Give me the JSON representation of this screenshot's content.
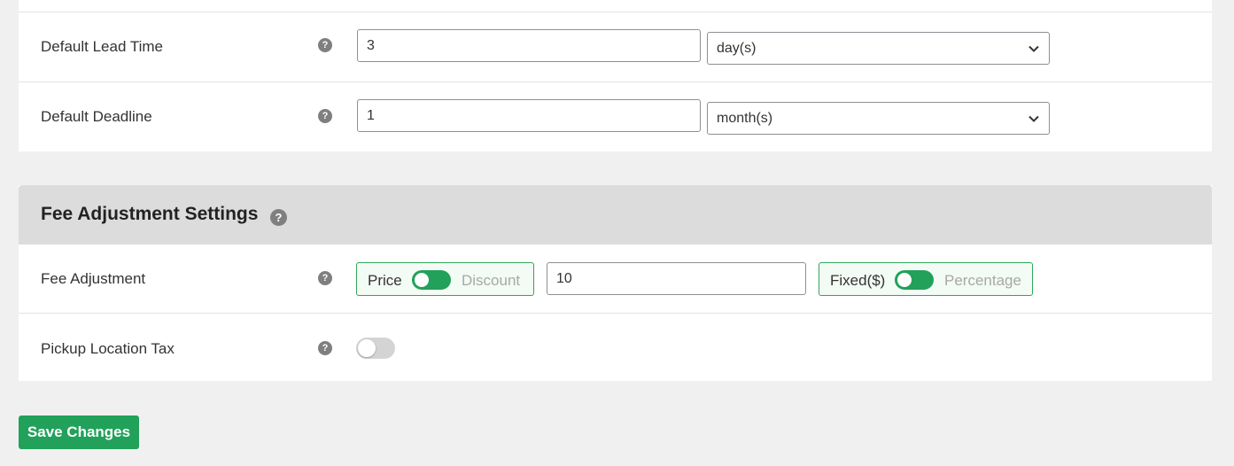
{
  "lead_time": {
    "label": "Default Lead Time",
    "help_icon": "question-icon",
    "value": "3",
    "unit": "day(s)"
  },
  "deadline": {
    "label": "Default Deadline",
    "help_icon": "question-icon",
    "value": "1",
    "unit": "month(s)"
  },
  "fee_section": {
    "title": "Fee Adjustment Settings",
    "help_icon": "question-icon"
  },
  "fee_adjustment": {
    "label": "Fee Adjustment",
    "type_toggle": {
      "left": "Price",
      "right": "Discount",
      "active": "Price"
    },
    "amount": "10",
    "mode_toggle": {
      "left": "Fixed($)",
      "right": "Percentage",
      "active": "Fixed($)"
    }
  },
  "pickup_tax": {
    "label": "Pickup Location Tax",
    "enabled": false
  },
  "save_button": {
    "label": "Save Changes"
  },
  "colors": {
    "accent": "#21a15a",
    "header_bg": "#dcdcdc",
    "page_bg": "#f0f0f0"
  }
}
